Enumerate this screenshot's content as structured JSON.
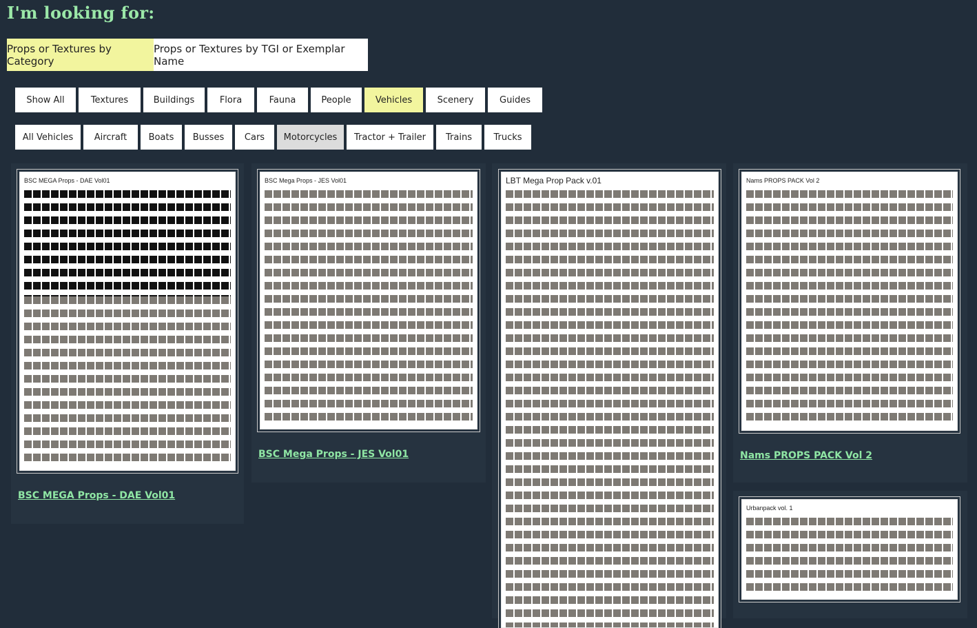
{
  "heading": "I'm looking for:",
  "mode_tabs": [
    "Props or Textures by Category",
    "Props or Textures by TGI or Exemplar Name"
  ],
  "categories": [
    "Show All",
    "Textures",
    "Buildings",
    "Flora",
    "Fauna",
    "People",
    "Vehicles",
    "Scenery",
    "Guides"
  ],
  "selected_category": "Vehicles",
  "subcategories": [
    "All Vehicles",
    "Aircraft",
    "Boats",
    "Busses",
    "Cars",
    "Motorcycles",
    "Tractor + Trailer",
    "Trains",
    "Trucks"
  ],
  "hovered_subcategory": "Motorcycles",
  "cards": [
    {
      "thumb_title": "BSC MEGA Props - DAE Vol01",
      "link": "BSC MEGA Props - DAE Vol01"
    },
    {
      "thumb_title": "BSC Mega Props - JES Vol01",
      "link": "BSC Mega Props - JES Vol01"
    },
    {
      "thumb_title": "LBT Mega Prop Pack v.01",
      "link": ""
    },
    {
      "thumb_title": "Nams PROPS PACK Vol 2",
      "link": "Nams PROPS PACK Vol 2"
    },
    {
      "thumb_title": "Urbanpack vol. 1",
      "link": ""
    }
  ],
  "colors": {
    "background": "#212d3a",
    "heading": "#9be8a8",
    "link": "#8fe6a4",
    "active": "#f2f59e",
    "card": "#263340"
  }
}
